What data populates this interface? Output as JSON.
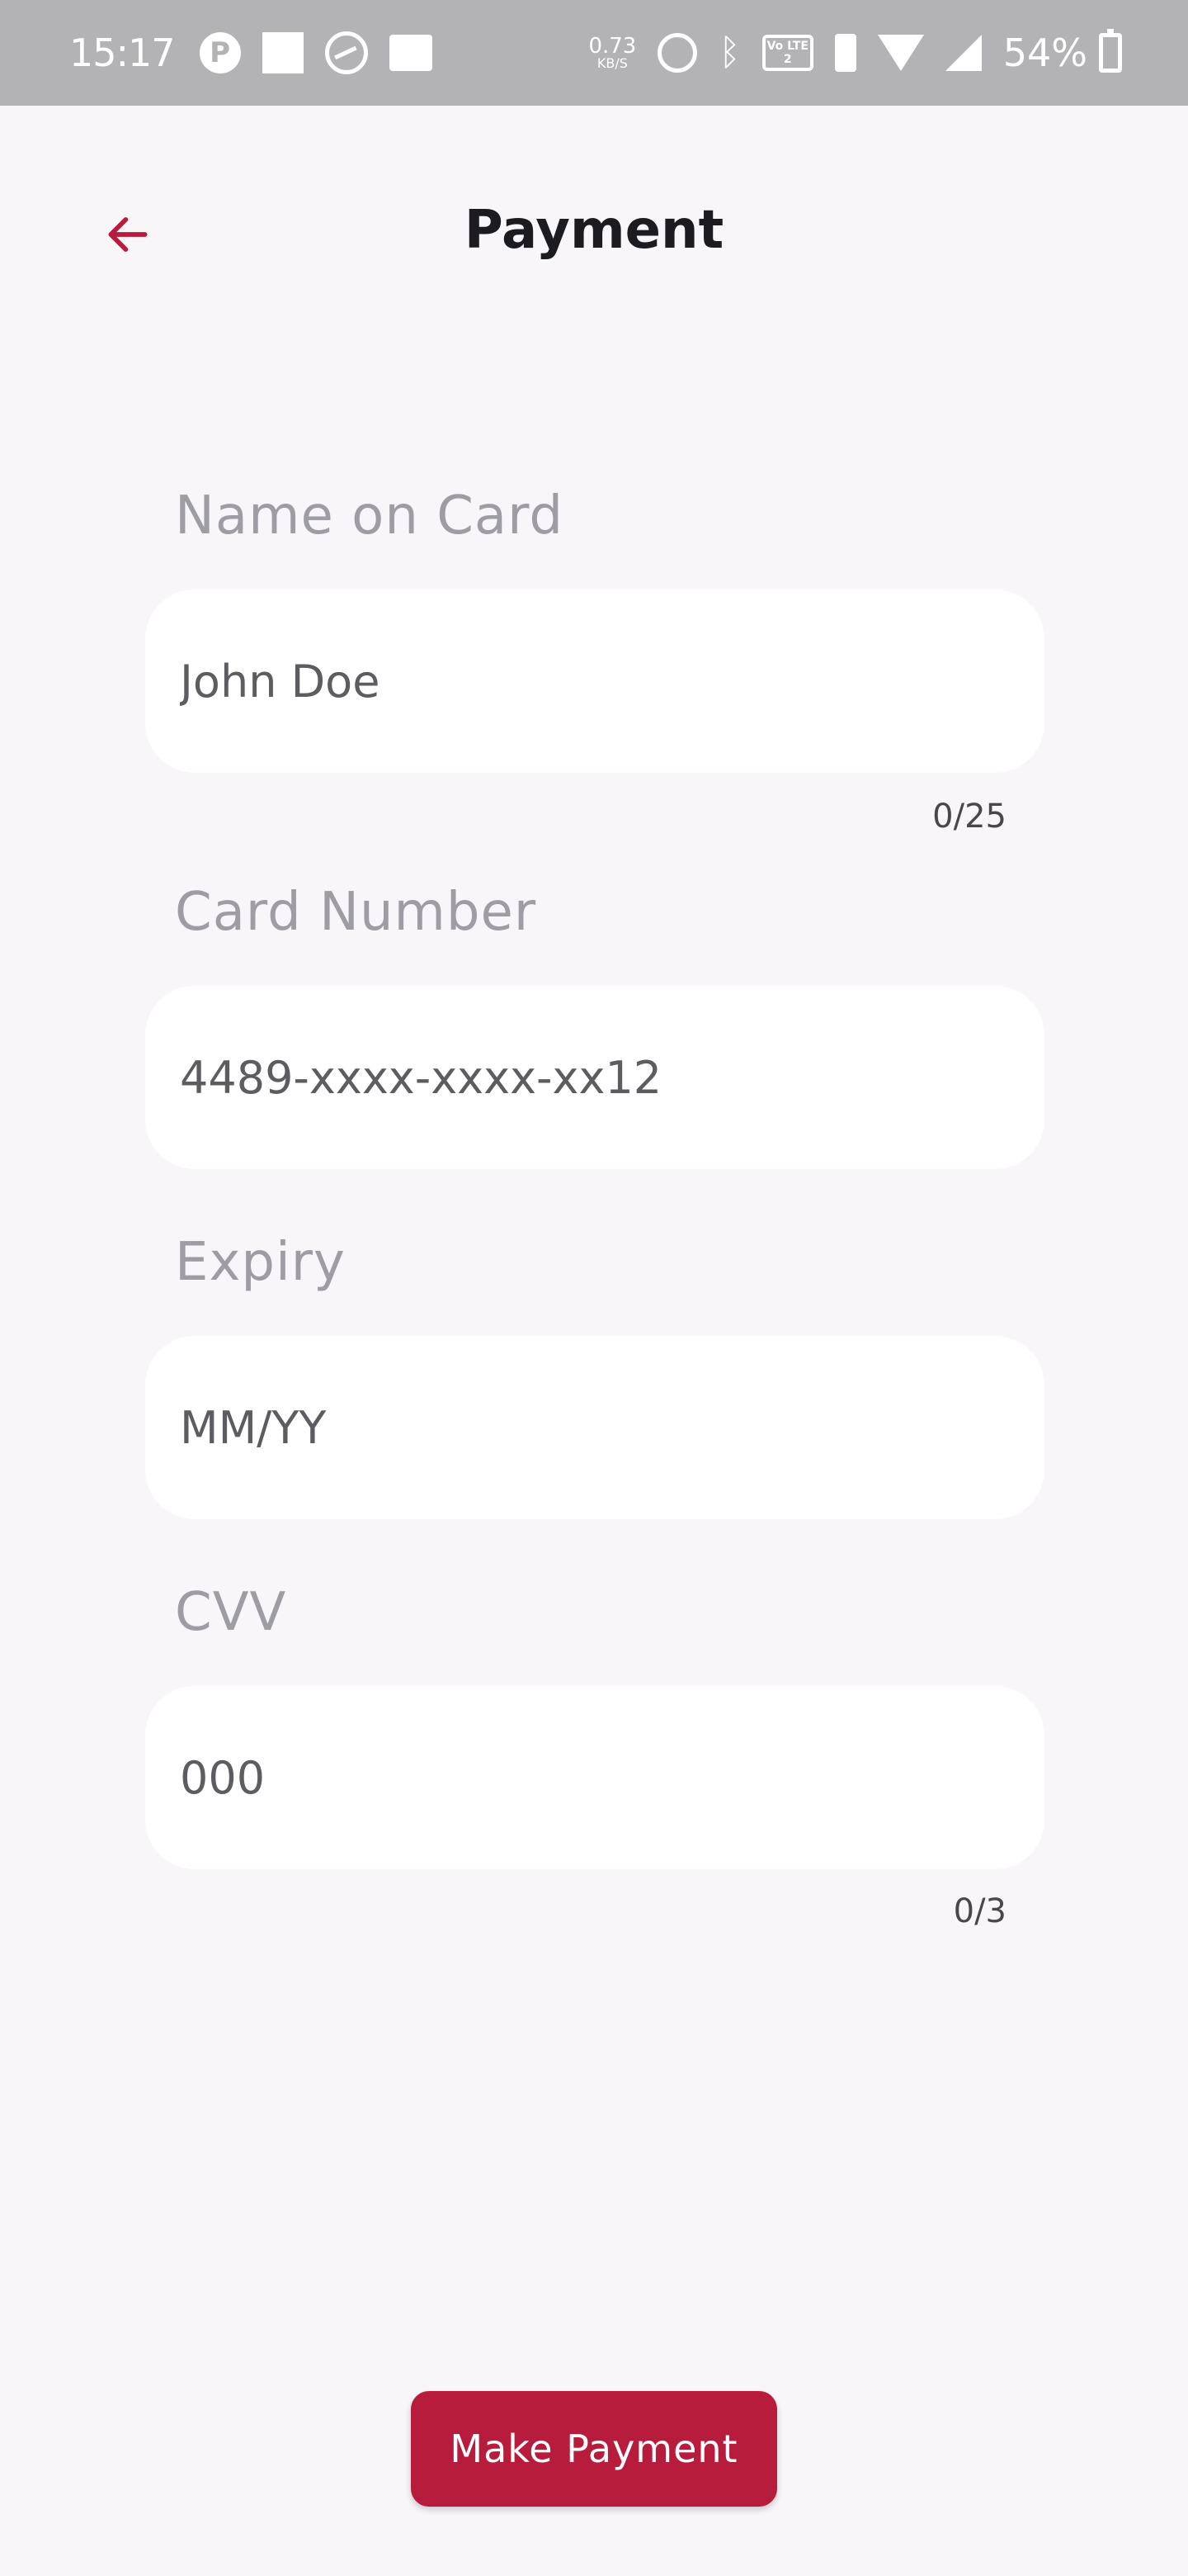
{
  "status_bar": {
    "time": "15:17",
    "net_speed_value": "0.73",
    "net_speed_unit": "KB/S",
    "volte_label": "Vo LTE 2",
    "battery_percent": "54%",
    "icons": [
      "app-notification-icon",
      "square-icon",
      "chart-icon",
      "device-icon",
      "alarm-icon",
      "bluetooth-icon",
      "volte-icon",
      "vibrate-icon",
      "wifi-icon",
      "signal-icon",
      "battery-icon"
    ]
  },
  "app_bar": {
    "title": "Payment",
    "back_icon": "arrow-left-icon",
    "accent_color": "#b71c3d"
  },
  "form": {
    "name": {
      "label": "Name on Card",
      "placeholder": "John Doe",
      "value": "",
      "counter": "0/25"
    },
    "card_number": {
      "label": "Card Number",
      "placeholder": "4489-xxxx-xxxx-xx12",
      "value": ""
    },
    "expiry": {
      "label": "Expiry",
      "placeholder": "MM/YY",
      "value": ""
    },
    "cvv": {
      "label": "CVV",
      "placeholder": "000",
      "value": "",
      "counter": "0/3"
    }
  },
  "actions": {
    "pay_label": "Make Payment",
    "pay_color": "#b71c3d"
  }
}
